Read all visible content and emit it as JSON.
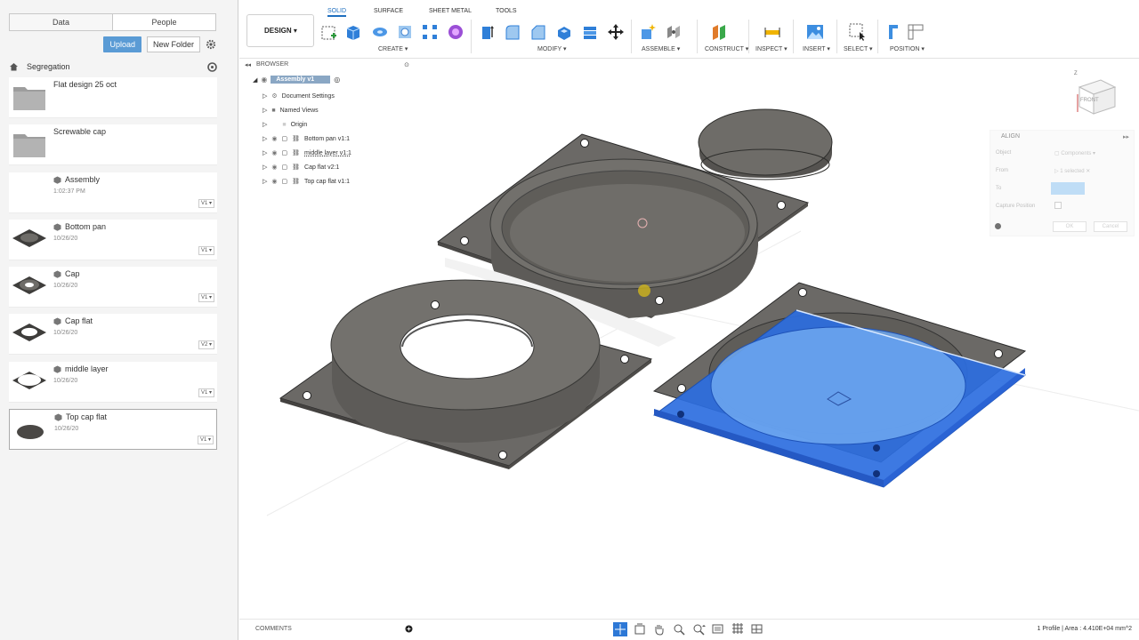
{
  "data_panel": {
    "tabs": [
      "Data",
      "People"
    ],
    "upload_label": "Upload",
    "new_folder_label": "New Folder",
    "breadcrumb": "Segregation",
    "items": [
      {
        "name": "Flat design 25 oct",
        "type": "folder",
        "date": "",
        "version": ""
      },
      {
        "name": "Screwable cap",
        "type": "folder",
        "date": "",
        "version": ""
      },
      {
        "name": "Assembly",
        "type": "design",
        "date": "1:02:37 PM",
        "version": "V1"
      },
      {
        "name": "Bottom pan",
        "type": "design",
        "date": "10/26/20",
        "version": "V1"
      },
      {
        "name": "Cap",
        "type": "design",
        "date": "10/26/20",
        "version": "V1"
      },
      {
        "name": "Cap flat",
        "type": "design",
        "date": "10/26/20",
        "version": "V2"
      },
      {
        "name": "middle layer",
        "type": "design",
        "date": "10/26/20",
        "version": "V1"
      },
      {
        "name": "Top cap flat",
        "type": "design",
        "date": "10/26/20",
        "version": "V1"
      }
    ]
  },
  "toolbar": {
    "workspace": "DESIGN",
    "tabs": [
      "SOLID",
      "SURFACE",
      "SHEET METAL",
      "TOOLS"
    ],
    "active_tab": "SOLID",
    "groups": [
      "CREATE",
      "MODIFY",
      "ASSEMBLE",
      "CONSTRUCT",
      "INSPECT",
      "INSERT",
      "SELECT",
      "POSITION"
    ]
  },
  "browser": {
    "title": "BROWSER",
    "root": "Assembly v1",
    "rows": [
      "Document Settings",
      "Named Views",
      "Origin",
      "Bottom pan v1:1",
      "middle layer v1:1",
      "Cap flat v2:1",
      "Top cap flat v1:1"
    ]
  },
  "align_dialog": {
    "title": "ALIGN",
    "object_label": "Object",
    "object_value": "Components",
    "from_label": "From",
    "from_value": "1 selected",
    "to_label": "To",
    "capture_label": "Capture Position",
    "ok_label": "OK",
    "cancel_label": "Cancel"
  },
  "viewcube": {
    "face": "FRONT",
    "axis": "Z"
  },
  "bottom": {
    "comments": "COMMENTS",
    "status": "1 Profile | Area : 4.410E+04 mm^2"
  },
  "colors": {
    "accent": "#1f6fbf",
    "upload": "#5a9bd5",
    "body": "#6e6c68",
    "selection": "#2d6ee0"
  }
}
